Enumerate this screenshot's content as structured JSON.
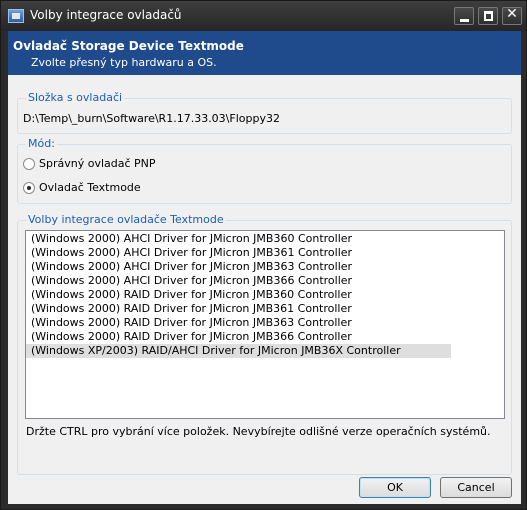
{
  "window": {
    "title": "Volby integrace ovladačů"
  },
  "header": {
    "title": "Ovladač Storage Device Textmode",
    "subtitle": "Zvolte přesný typ hardwaru a OS."
  },
  "driver_folder": {
    "label": "Složka s ovladači",
    "path": "D:\\Temp\\_burn\\Software\\R1.17.33.03\\Floppy32"
  },
  "mode": {
    "label": "Mód:",
    "options": [
      {
        "label": "Správný ovladač PNP",
        "checked": false
      },
      {
        "label": "Ovladač Textmode",
        "checked": true
      }
    ]
  },
  "textmode": {
    "label": "Volby integrace ovladače Textmode",
    "items": [
      "(Windows 2000) AHCI Driver for JMicron JMB360 Controller",
      "(Windows 2000) AHCI Driver for JMicron JMB361 Controller",
      "(Windows 2000) AHCI Driver for JMicron JMB363 Controller",
      "(Windows 2000) AHCI Driver for JMicron JMB366 Controller",
      "(Windows 2000) RAID Driver for JMicron JMB360 Controller",
      "(Windows 2000) RAID Driver for JMicron JMB361 Controller",
      "(Windows 2000) RAID Driver for JMicron JMB363 Controller",
      "(Windows 2000) RAID Driver for JMicron JMB366 Controller",
      "(Windows XP/2003) RAID/AHCI Driver for JMicron JMB36X Controller"
    ],
    "selected_index": 8,
    "hint": "Držte CTRL pro vybrání více položek. Nevybírejte odlišné verze operačních systémů."
  },
  "buttons": {
    "ok": "OK",
    "cancel": "Cancel"
  },
  "colors": {
    "header_bg": "#1f4b8c",
    "group_label": "#1a5fb4",
    "titlebar": "#2b2b2b"
  }
}
